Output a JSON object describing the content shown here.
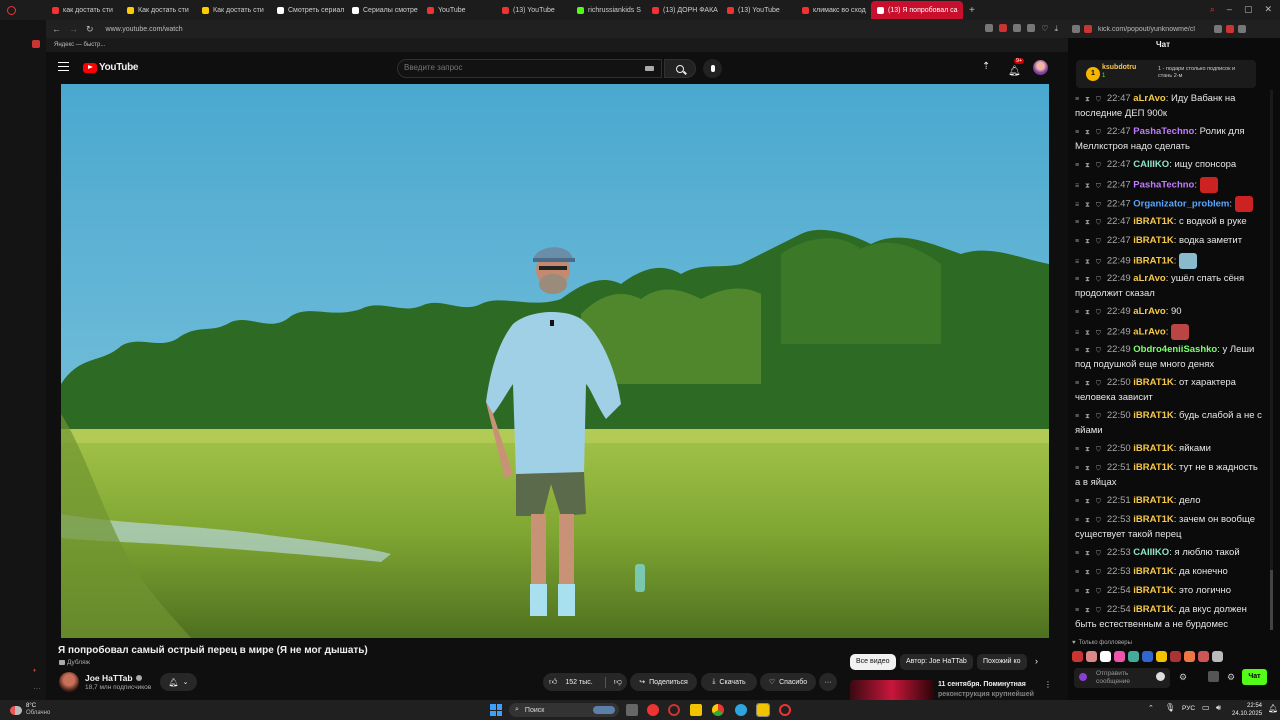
{
  "browser": {
    "tabs": [
      {
        "label": "как достать сти",
        "color": "#e33"
      },
      {
        "label": "Как достать сти",
        "color": "#fc0"
      },
      {
        "label": "Как достать сти",
        "color": "#fc0"
      },
      {
        "label": "Смотреть сериал",
        "color": "#fff"
      },
      {
        "label": "Сериалы смотре",
        "color": "#fff"
      },
      {
        "label": "YouTube",
        "color": "#e33"
      },
      {
        "label": "(13) YouTube",
        "color": "#e33"
      },
      {
        "label": "richrussiankids S",
        "color": "#53fc18"
      },
      {
        "label": "(13) ДОРН ФАКА",
        "color": "#e33"
      },
      {
        "label": "(13) YouTube",
        "color": "#e33"
      },
      {
        "label": "климакс во сход",
        "color": "#e33"
      },
      {
        "label": "(13) Я попробовал са",
        "color": "#fff"
      }
    ],
    "url": "www.youtube.com/watch",
    "bookmark": "Яндекс — быстр...",
    "chat_url": "kick.com/popout/yunknowme/cl"
  },
  "youtube": {
    "logo": "YouTube",
    "search_placeholder": "Введите запрос",
    "notif_count": "9+",
    "video_title": "Я попробовал самый острый перец в мире (Я не мог дышать)",
    "dub_label": "Дубляж",
    "channel_name": "Joe HaTTab",
    "subscribers": "18,7 млн подписчиков",
    "likes": "152 тыс.",
    "share": "Поделиться",
    "download": "Скачать",
    "thanks": "Спасибо",
    "chips": [
      "Все видео",
      "Автор: Joe HaTTab",
      "Похожий ко"
    ],
    "rec_title_1": "11 сентября. Поминутная",
    "rec_title_2": "реконструкция крупнейшей"
  },
  "chat": {
    "header": "Чат",
    "top_user": "ksubdotru",
    "top_user_count": "1",
    "top_note_1": "1 - подари столько подписок и",
    "top_note_2": "стань 2-м",
    "messages": [
      {
        "time": "22:47",
        "user": "aLrAvo",
        "color": "#f7c948",
        "text": "Иду Вабанк на последние ДЕП 900к"
      },
      {
        "time": "22:47",
        "user": "PashaTechno",
        "color": "#c27bff",
        "text": "Ролик для Меллкстроя надо сделать"
      },
      {
        "time": "22:47",
        "user": "CAIIIKO",
        "color": "#8fe3c5",
        "text": "ищу спонсора"
      },
      {
        "time": "22:47",
        "user": "PashaTechno",
        "color": "#c27bff",
        "text": ""
      },
      {
        "time": "22:47",
        "user": "Organizator_problem",
        "color": "#5aa6ff",
        "text": ""
      },
      {
        "time": "22:47",
        "user": "iBRAT1K",
        "color": "#f7c948",
        "text": "с водкой в руке"
      },
      {
        "time": "22:47",
        "user": "iBRAT1K",
        "color": "#f7c948",
        "text": "водка заметит"
      },
      {
        "time": "22:49",
        "user": "iBRAT1K",
        "color": "#f7c948",
        "text": ""
      },
      {
        "time": "22:49",
        "user": "aLrAvo",
        "color": "#f7c948",
        "text": "ушёл спать сёня продолжит сказал"
      },
      {
        "time": "22:49",
        "user": "aLrAvo",
        "color": "#f7c948",
        "text": "90"
      },
      {
        "time": "22:49",
        "user": "aLrAvo",
        "color": "#f7c948",
        "text": ""
      },
      {
        "time": "22:49",
        "user": "Obdro4eniiSashko",
        "color": "#7cff6b",
        "text": "у Леши под подушкой еще много денях"
      },
      {
        "time": "22:50",
        "user": "iBRAT1K",
        "color": "#f7c948",
        "text": "от характера человека зависит"
      },
      {
        "time": "22:50",
        "user": "iBRAT1K",
        "color": "#f7c948",
        "text": "будь слабой а не с яйами"
      },
      {
        "time": "22:50",
        "user": "iBRAT1K",
        "color": "#f7c948",
        "text": "яйками"
      },
      {
        "time": "22:51",
        "user": "iBRAT1K",
        "color": "#f7c948",
        "text": "тут не в жадность а в яйцах"
      },
      {
        "time": "22:51",
        "user": "iBRAT1K",
        "color": "#f7c948",
        "text": "дело"
      },
      {
        "time": "22:53",
        "user": "iBRAT1K",
        "color": "#f7c948",
        "text": "зачем он вообще существует такой перец"
      },
      {
        "time": "22:53",
        "user": "CAIIIKO",
        "color": "#8fe3c5",
        "text": "я люблю такой"
      },
      {
        "time": "22:53",
        "user": "iBRAT1K",
        "color": "#f7c948",
        "text": "да конечно"
      },
      {
        "time": "22:54",
        "user": "iBRAT1K",
        "color": "#f7c948",
        "text": "это логично"
      },
      {
        "time": "22:54",
        "user": "iBRAT1K",
        "color": "#f7c948",
        "text": "да вкус должен быть естественным а не бурдомес"
      }
    ],
    "followers_only": "Только фолловеры",
    "input_placeholder": "Отправить сообщение",
    "send_label": "Чат"
  },
  "taskbar": {
    "weather_temp": "8°C",
    "weather_desc": "Облачно",
    "search": "Поиск",
    "lang": "РУС",
    "time": "22:54",
    "date": "24.10.2025"
  }
}
